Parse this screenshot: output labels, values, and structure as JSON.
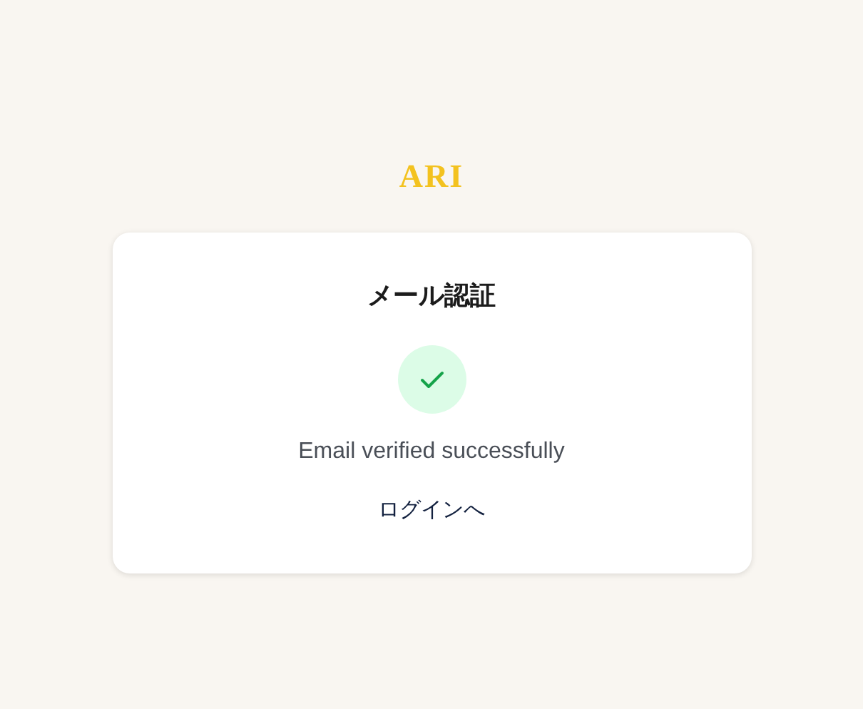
{
  "logo": "ARI",
  "card": {
    "title": "メール認証",
    "status": {
      "kind": "success",
      "message": "Email verified successfully"
    },
    "link": "ログインへ"
  }
}
